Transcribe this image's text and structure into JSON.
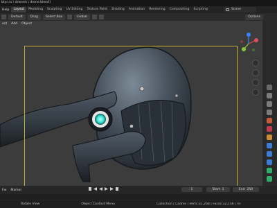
{
  "titlebar": {
    "text": "btyr.cs \\ drones\\ \\ drone.blend]"
  },
  "topbar": {
    "menu": [
      "Help"
    ],
    "workspaces": [
      {
        "label": "Layout",
        "active": true
      },
      {
        "label": "Modeling",
        "active": false
      },
      {
        "label": "Sculpting",
        "active": false
      },
      {
        "label": "UV Editing",
        "active": false
      },
      {
        "label": "Texture Paint",
        "active": false
      },
      {
        "label": "Shading",
        "active": false
      },
      {
        "label": "Animation",
        "active": false
      },
      {
        "label": "Rendering",
        "active": false
      },
      {
        "label": "Compositing",
        "active": false
      },
      {
        "label": "Scripting",
        "active": false
      }
    ],
    "scene": "Scene"
  },
  "viewport_header": {
    "orientation": "Default",
    "drag": "Drag",
    "select": "Select Box",
    "transform": "Global",
    "options": "Options"
  },
  "viewport_menu": [
    "ect",
    "Add",
    "Object"
  ],
  "timeline": {
    "menu": [
      "Fw",
      "Marker"
    ],
    "current_frame": "1",
    "start_label": "Start",
    "start_value": "1",
    "end_label": "End",
    "end_value": "250"
  },
  "statusbar": {
    "left": "Rotate View",
    "middle": "Object Context Menu",
    "right": "Collection | Cadres | Verts:31,268 | Faces:32,156 | Tris:62,122 | Objects:"
  },
  "colors": {
    "accent": "#4772b3",
    "camera_frame": "#c6b22b",
    "axis_x": "#e04b5a",
    "axis_y": "#8cc63f",
    "axis_z": "#3b82f6",
    "glow": "#3ce0d0"
  }
}
